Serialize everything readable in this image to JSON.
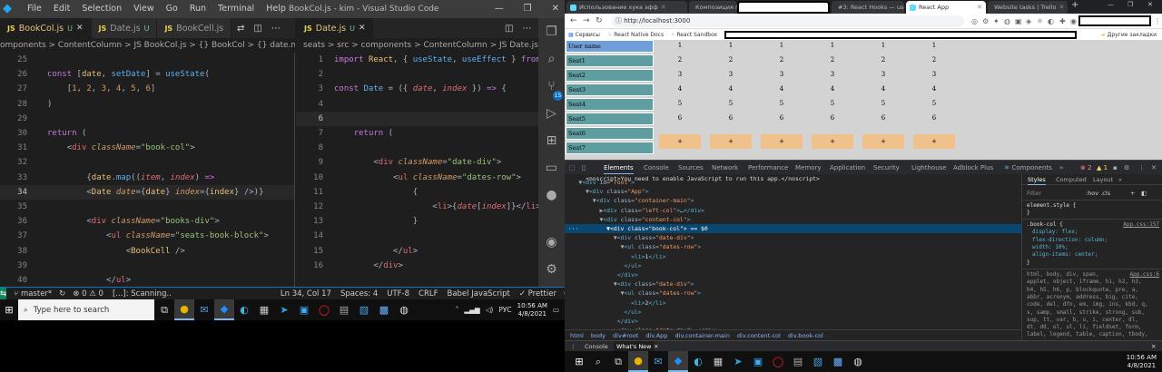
{
  "vscode": {
    "menu": [
      "File",
      "Edit",
      "Selection",
      "View",
      "Go",
      "Run",
      "Terminal",
      "Help"
    ],
    "window_title": "BookCol.js - kim - Visual Studio Code",
    "left_tabs": [
      {
        "label": "BookCol.js",
        "badge": "U",
        "active": true
      },
      {
        "label": "Date.js",
        "badge": "U",
        "active": false
      },
      {
        "label": "BookCell.js",
        "badge": "",
        "active": false
      }
    ],
    "right_tabs": [
      {
        "label": "Date.js",
        "badge": "U",
        "active": true
      }
    ],
    "left_breadcrumb": "omponents > ContentColumn > JS BookCol.js > {} BookCol > {} date.map() callback",
    "right_breadcrumb": "seats > src > components > ContentColumn > JS Date.js > {} Date",
    "status": {
      "branch": "master*",
      "problems": "⊗ 0 ⚠ 0",
      "scanning": "[...]: Scanning..",
      "position": "Ln 34, Col 17",
      "spaces": "Spaces: 4",
      "encoding": "UTF-8",
      "eol": "CRLF",
      "language": "Babel JavaScript",
      "formatter": "✓ Prettier"
    },
    "activity_badge": "15"
  },
  "taskbar": {
    "search_placeholder": "Type here to search",
    "clock_time": "10:56 AM",
    "clock_date": "4/8/2021",
    "lang": "РУС"
  },
  "chrome": {
    "tabs": [
      {
        "label": "Использование хука эфф",
        "active": false,
        "redacted": false
      },
      {
        "label": "Композиция против нас",
        "active": false,
        "redacted": false
      },
      {
        "label": "",
        "active": false,
        "redacted": true
      },
      {
        "label": "#3: React Hooks — useEffe",
        "active": false,
        "redacted": false
      },
      {
        "label": "React App",
        "active": true,
        "redacted": false
      },
      {
        "label": "Website tasks | Trello",
        "active": false,
        "redacted": false
      }
    ],
    "url": "http://localhost:3000",
    "bookmarks": [
      "Сервисы",
      "React Native Docs",
      "React Sandbox"
    ],
    "other_bookmarks": "Другие закладки"
  },
  "page": {
    "seat_rows": [
      "User name",
      "Seat1",
      "Seat2",
      "Seat3",
      "Seat4",
      "Seat5",
      "Seat6",
      "Seat7"
    ],
    "date_rows": [
      "1",
      "2",
      "3",
      "4",
      "5",
      "6",
      "+"
    ],
    "date_columns": 6
  },
  "devtools": {
    "tabs": [
      "Elements",
      "Console",
      "Sources",
      "Network",
      "Performance",
      "Memory",
      "Application",
      "Security",
      "Lighthouse",
      "Adblock Plus",
      "Components"
    ],
    "errors": "2",
    "warnings": "1",
    "breadcrumb": [
      "html",
      "body",
      "div#root",
      "div.App",
      "div.container-main",
      "div.content-col",
      "div.book-col"
    ],
    "styles_tabs": [
      "Styles",
      "Computed",
      "Layout"
    ],
    "filter_placeholder": "Filter",
    "filter_buttons": ":hov  .cls",
    "element_style": "element.style {",
    "close_brace": "}",
    "rule_selector": ".book-col {",
    "rule_source": "App.css:157",
    "rule_props": [
      "display: flex;",
      "flex-direction: column;",
      "width: 10%;",
      "align-items: center;"
    ],
    "ua_source": "App.css:6",
    "ua_text": [
      "html, body, div, span,",
      "applet, object, iframe, h1, h2, h3,",
      "h4, h5, h6, p, blockquote, pre, a,",
      "abbr, acronym, address, big, cite,",
      "code, del, dfn, em, img, ins, kbd, q,",
      "s, samp, small, strike, strong, sub,",
      "sup, tt, var, b, u, i, center, dl,",
      "dt, dd, ol, ul, li, fieldset, form,",
      "label, legend, table, caption, tbody,"
    ],
    "drawer_tabs": [
      "Console",
      "What's New"
    ]
  }
}
